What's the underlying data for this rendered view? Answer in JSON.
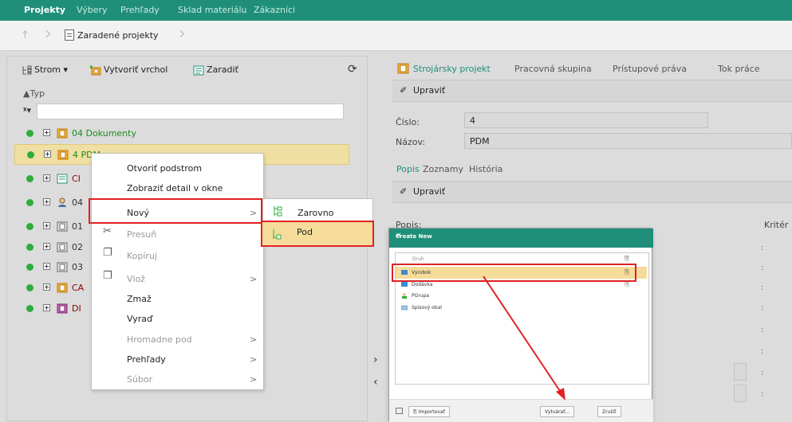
{
  "topnav": {
    "items": [
      "Projekty",
      "Výbery",
      "Prehľady",
      "Sklad materiálu",
      "Zákazníci"
    ]
  },
  "breadcrumb": {
    "label": "Zaradené projekty"
  },
  "left_toolbar": {
    "tree": "Strom ▾",
    "create_root": "Vytvoriť vrchol",
    "assign": "Zaradiť"
  },
  "tree": {
    "sort_header": "▲Typ",
    "rows": [
      {
        "label": "04 Dokumenty"
      },
      {
        "label": "4 PDM"
      },
      {
        "label": "CI"
      },
      {
        "label": "04"
      },
      {
        "label": "01"
      },
      {
        "label": "02"
      },
      {
        "label": "03"
      },
      {
        "label": "CA"
      },
      {
        "label": "DI"
      }
    ]
  },
  "right_tabs": [
    "Strojársky projekt",
    "Pracovná skupina",
    "Prístupové práva",
    "Tok práce"
  ],
  "edit_label": "Upraviť",
  "fields": {
    "number_label": "Číslo:",
    "number_value": "4",
    "name_label": "Názov:",
    "name_value": "PDM"
  },
  "sub_tabs": [
    "Popis",
    "Zoznamy",
    "História"
  ],
  "description_label": "Popis:",
  "criteria_label": "Kritér",
  "context_menu": {
    "items": [
      {
        "label": "Otvoriť podstrom",
        "disabled": false,
        "arrow": ""
      },
      {
        "label": "Zobraziť detail v okne",
        "disabled": false,
        "arrow": ""
      },
      {
        "label": "Nový",
        "disabled": false,
        "arrow": ">"
      },
      {
        "label": "Presuň",
        "disabled": true,
        "arrow": ""
      },
      {
        "label": "Kopíruj",
        "disabled": true,
        "arrow": ""
      },
      {
        "label": "Vlož",
        "disabled": true,
        "arrow": ">"
      },
      {
        "label": "Zmaž",
        "disabled": false,
        "arrow": ""
      },
      {
        "label": "Vyraď",
        "disabled": false,
        "arrow": ""
      },
      {
        "label": "Hromadne pod",
        "disabled": true,
        "arrow": ">"
      },
      {
        "label": "Prehľady",
        "disabled": false,
        "arrow": ">"
      },
      {
        "label": "Súbor",
        "disabled": true,
        "arrow": ">"
      }
    ]
  },
  "submenu": {
    "items": [
      "Zarovno",
      "Pod"
    ]
  },
  "dialog": {
    "title": "Create New",
    "close": "×",
    "header": "Druh",
    "rows": [
      "Výrobok",
      "Dodávka",
      "PGrupa",
      "Spisový obal"
    ],
    "import_button": "Importovať",
    "create_button": "Vytvárať...",
    "cancel_button": "Zrušiť"
  },
  "colors": {
    "accent": "#1f8f79",
    "highlight": "#e02222",
    "selection": "#f0dfa3",
    "status_green": "#2eac3b"
  }
}
